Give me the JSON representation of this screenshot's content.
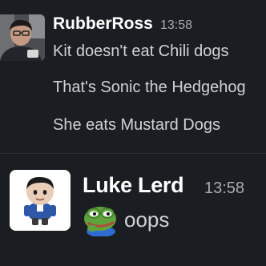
{
  "theme": {
    "background": "#1a1d21",
    "text": "#d1d2d3",
    "author": "#ffffff",
    "timestamp": "#ababad"
  },
  "messages": [
    {
      "author": "RubberRoss",
      "time": "13:58",
      "avatar_icon": "user-photo-avatar",
      "lines": [
        "Kit doesn't eat Chili dogs",
        "That's Sonic the Hedgehog",
        "She eats Mustard Dogs"
      ]
    },
    {
      "author": "Luke Lerd",
      "time": "13:58",
      "avatar_icon": "plush-doll-avatar",
      "emoji_icon": "pepe-frog-emoji",
      "text": "oops"
    }
  ]
}
